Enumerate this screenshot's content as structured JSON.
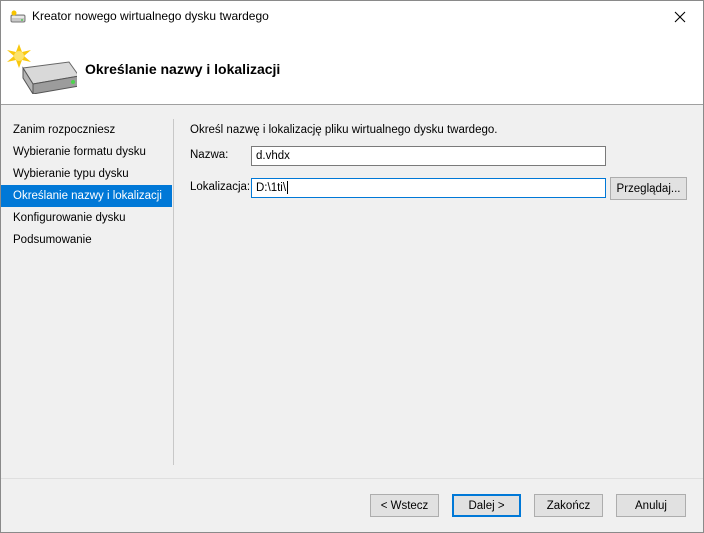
{
  "window": {
    "title": "Kreator nowego wirtualnego dysku twardego"
  },
  "header": {
    "title": "Określanie nazwy i lokalizacji"
  },
  "nav": {
    "items": [
      {
        "label": "Zanim rozpoczniesz",
        "active": false
      },
      {
        "label": "Wybieranie formatu dysku",
        "active": false
      },
      {
        "label": "Wybieranie typu dysku",
        "active": false
      },
      {
        "label": "Określanie nazwy i lokalizacji",
        "active": true
      },
      {
        "label": "Konfigurowanie dysku",
        "active": false
      },
      {
        "label": "Podsumowanie",
        "active": false
      }
    ]
  },
  "main": {
    "instruction": "Określ nazwę i lokalizację pliku wirtualnego dysku twardego.",
    "name_label": "Nazwa:",
    "name_value": "d.vhdx",
    "location_label": "Lokalizacja:",
    "location_value": "D:\\1ti\\",
    "browse_label": "Przeglądaj..."
  },
  "footer": {
    "back_label": "< Wstecz",
    "next_label": "Dalej >",
    "finish_label": "Zakończ",
    "cancel_label": "Anuluj"
  },
  "colors": {
    "accent": "#0078d7",
    "background": "#f0f0f0"
  }
}
